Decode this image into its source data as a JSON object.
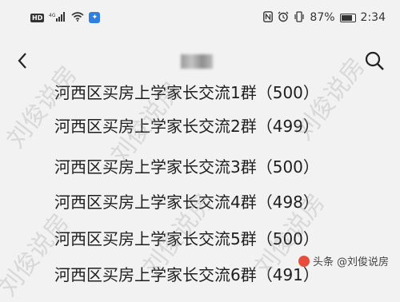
{
  "status_bar": {
    "left_icons": [
      "hd-badge",
      "4g-signal-icon",
      "wifi-icon",
      "app-icon"
    ],
    "hd_label": "HD",
    "network_label": "4G",
    "right_icons": [
      "nfc-icon",
      "alarm-icon",
      "vibrate-icon"
    ],
    "battery_percent": "87%",
    "battery_level": 0.87,
    "time": "2:34"
  },
  "nav": {
    "back_icon": "chevron-left-icon",
    "search_icon": "search-icon"
  },
  "groups": [
    {
      "name": "河西区买房上学家长交流1群",
      "count": "（500）"
    },
    {
      "name": "河西区买房上学家长交流2群",
      "count": "（499）"
    },
    {
      "name": "河西区买房上学家长交流3群",
      "count": "（500）"
    },
    {
      "name": "河西区买房上学家长交流4群",
      "count": "（498）"
    },
    {
      "name": "河西区买房上学家长交流5群",
      "count": "（500）"
    },
    {
      "name": "河西区买房上学家长交流6群",
      "count": "（491）"
    }
  ],
  "watermark": "刘俊说房",
  "brand": {
    "prefix": "头条",
    "suffix": "@刘俊说房"
  }
}
